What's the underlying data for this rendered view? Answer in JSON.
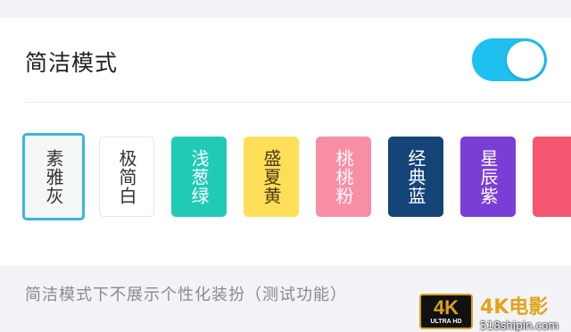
{
  "setting": {
    "title": "简洁模式",
    "toggle_on": true,
    "description": "简洁模式下不展示个性化装扮（测试功能）"
  },
  "themes": [
    {
      "label": "素雅灰",
      "selected": true,
      "bg": "#f4f6f8",
      "fg": "#333333"
    },
    {
      "label": "极简白",
      "selected": false,
      "bg": "#ffffff",
      "fg": "#333333"
    },
    {
      "label": "浅葱绿",
      "selected": false,
      "bg": "#20cbb6",
      "fg": "#ffffff"
    },
    {
      "label": "盛夏黄",
      "selected": false,
      "bg": "#fedf57",
      "fg": "#4a3d1a"
    },
    {
      "label": "桃桃粉",
      "selected": false,
      "bg": "#f88ea5",
      "fg": "#ffffff"
    },
    {
      "label": "经典蓝",
      "selected": false,
      "bg": "#154479",
      "fg": "#ffffff"
    },
    {
      "label": "星辰紫",
      "selected": false,
      "bg": "#7a3ed6",
      "fg": "#ffffff"
    },
    {
      "label": "",
      "selected": false,
      "bg": "#f4566f",
      "fg": "#ffffff"
    }
  ],
  "colors": {
    "accent": "#1ec0ef",
    "selected_border": "#3bb5dc"
  },
  "watermark": {
    "badge": "4K",
    "badge_sub": "ULTRA HD",
    "name": "4K电影",
    "url": "518shipin.com"
  }
}
